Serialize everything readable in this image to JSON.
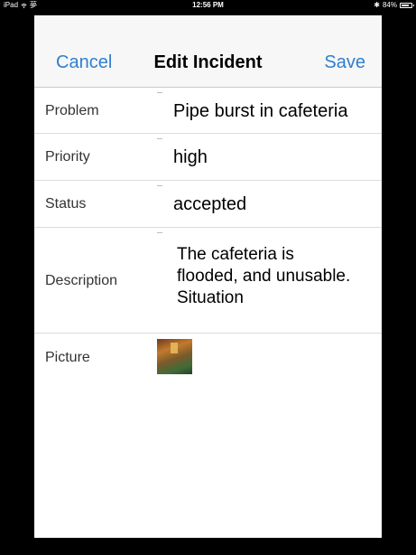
{
  "status_bar": {
    "device": "iPad",
    "carrier": "夢",
    "time": "12:56 PM",
    "battery": "84%",
    "battery_level": 0.84
  },
  "nav": {
    "cancel_label": "Cancel",
    "title": "Edit Incident",
    "save_label": "Save"
  },
  "form": {
    "fields": [
      {
        "label": "Problem",
        "value": "Pipe burst in cafeteria"
      },
      {
        "label": "Priority",
        "value": "high"
      },
      {
        "label": "Status",
        "value": "accepted"
      },
      {
        "label": "Description",
        "value": "The cafeteria is flooded, and unusable. Situation"
      },
      {
        "label": "Picture"
      }
    ]
  },
  "colors": {
    "accent": "#2f7fd0",
    "background": "#000000",
    "sheet": "#ffffff"
  }
}
